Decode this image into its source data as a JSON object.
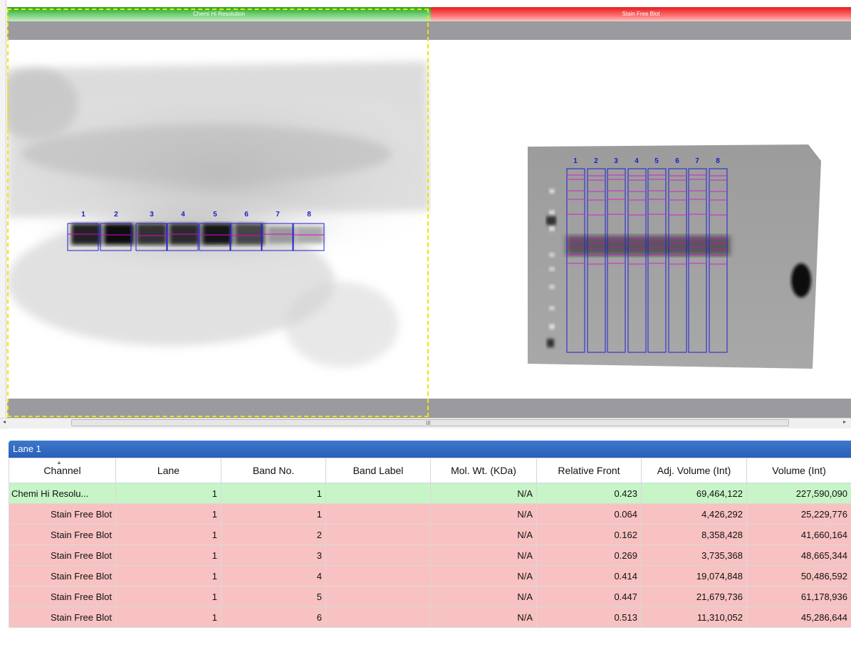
{
  "viewer": {
    "left_panel_title": "Chemi Hi Resolution",
    "right_panel_title": "Stain Free Blot",
    "scrollbar_grip": "III",
    "left_lanes": [
      "1",
      "2",
      "3",
      "4",
      "5",
      "6",
      "7",
      "8"
    ],
    "right_lanes": [
      "1",
      "2",
      "3",
      "4",
      "5",
      "6",
      "7",
      "8"
    ],
    "colors": {
      "green_title": "#24a424",
      "red_title": "#e41f1f",
      "lane_box": "#2020d0",
      "band_line": "#e000e0",
      "selection": "#e8e800"
    }
  },
  "table": {
    "title": "Lane 1",
    "columns": [
      "Channel",
      "Lane",
      "Band No.",
      "Band Label",
      "Mol. Wt. (KDa)",
      "Relative Front",
      "Adj. Volume (Int)",
      "Volume (Int)"
    ],
    "rows": [
      {
        "channel": "Chemi Hi Resolu...",
        "lane": "1",
        "band": "1",
        "label": "",
        "mw": "N/A",
        "rf": "0.423",
        "adj": "69,464,122",
        "vol": "227,590,090",
        "kind": "green"
      },
      {
        "channel": "Stain Free Blot",
        "lane": "1",
        "band": "1",
        "label": "",
        "mw": "N/A",
        "rf": "0.064",
        "adj": "4,426,292",
        "vol": "25,229,776",
        "kind": "red"
      },
      {
        "channel": "Stain Free Blot",
        "lane": "1",
        "band": "2",
        "label": "",
        "mw": "N/A",
        "rf": "0.162",
        "adj": "8,358,428",
        "vol": "41,660,164",
        "kind": "red"
      },
      {
        "channel": "Stain Free Blot",
        "lane": "1",
        "band": "3",
        "label": "",
        "mw": "N/A",
        "rf": "0.269",
        "adj": "3,735,368",
        "vol": "48,665,344",
        "kind": "red"
      },
      {
        "channel": "Stain Free Blot",
        "lane": "1",
        "band": "4",
        "label": "",
        "mw": "N/A",
        "rf": "0.414",
        "adj": "19,074,848",
        "vol": "50,486,592",
        "kind": "red"
      },
      {
        "channel": "Stain Free Blot",
        "lane": "1",
        "band": "5",
        "label": "",
        "mw": "N/A",
        "rf": "0.447",
        "adj": "21,679,736",
        "vol": "61,178,936",
        "kind": "red"
      },
      {
        "channel": "Stain Free Blot",
        "lane": "1",
        "band": "6",
        "label": "",
        "mw": "N/A",
        "rf": "0.513",
        "adj": "11,310,052",
        "vol": "45,286,644",
        "kind": "red"
      }
    ]
  }
}
